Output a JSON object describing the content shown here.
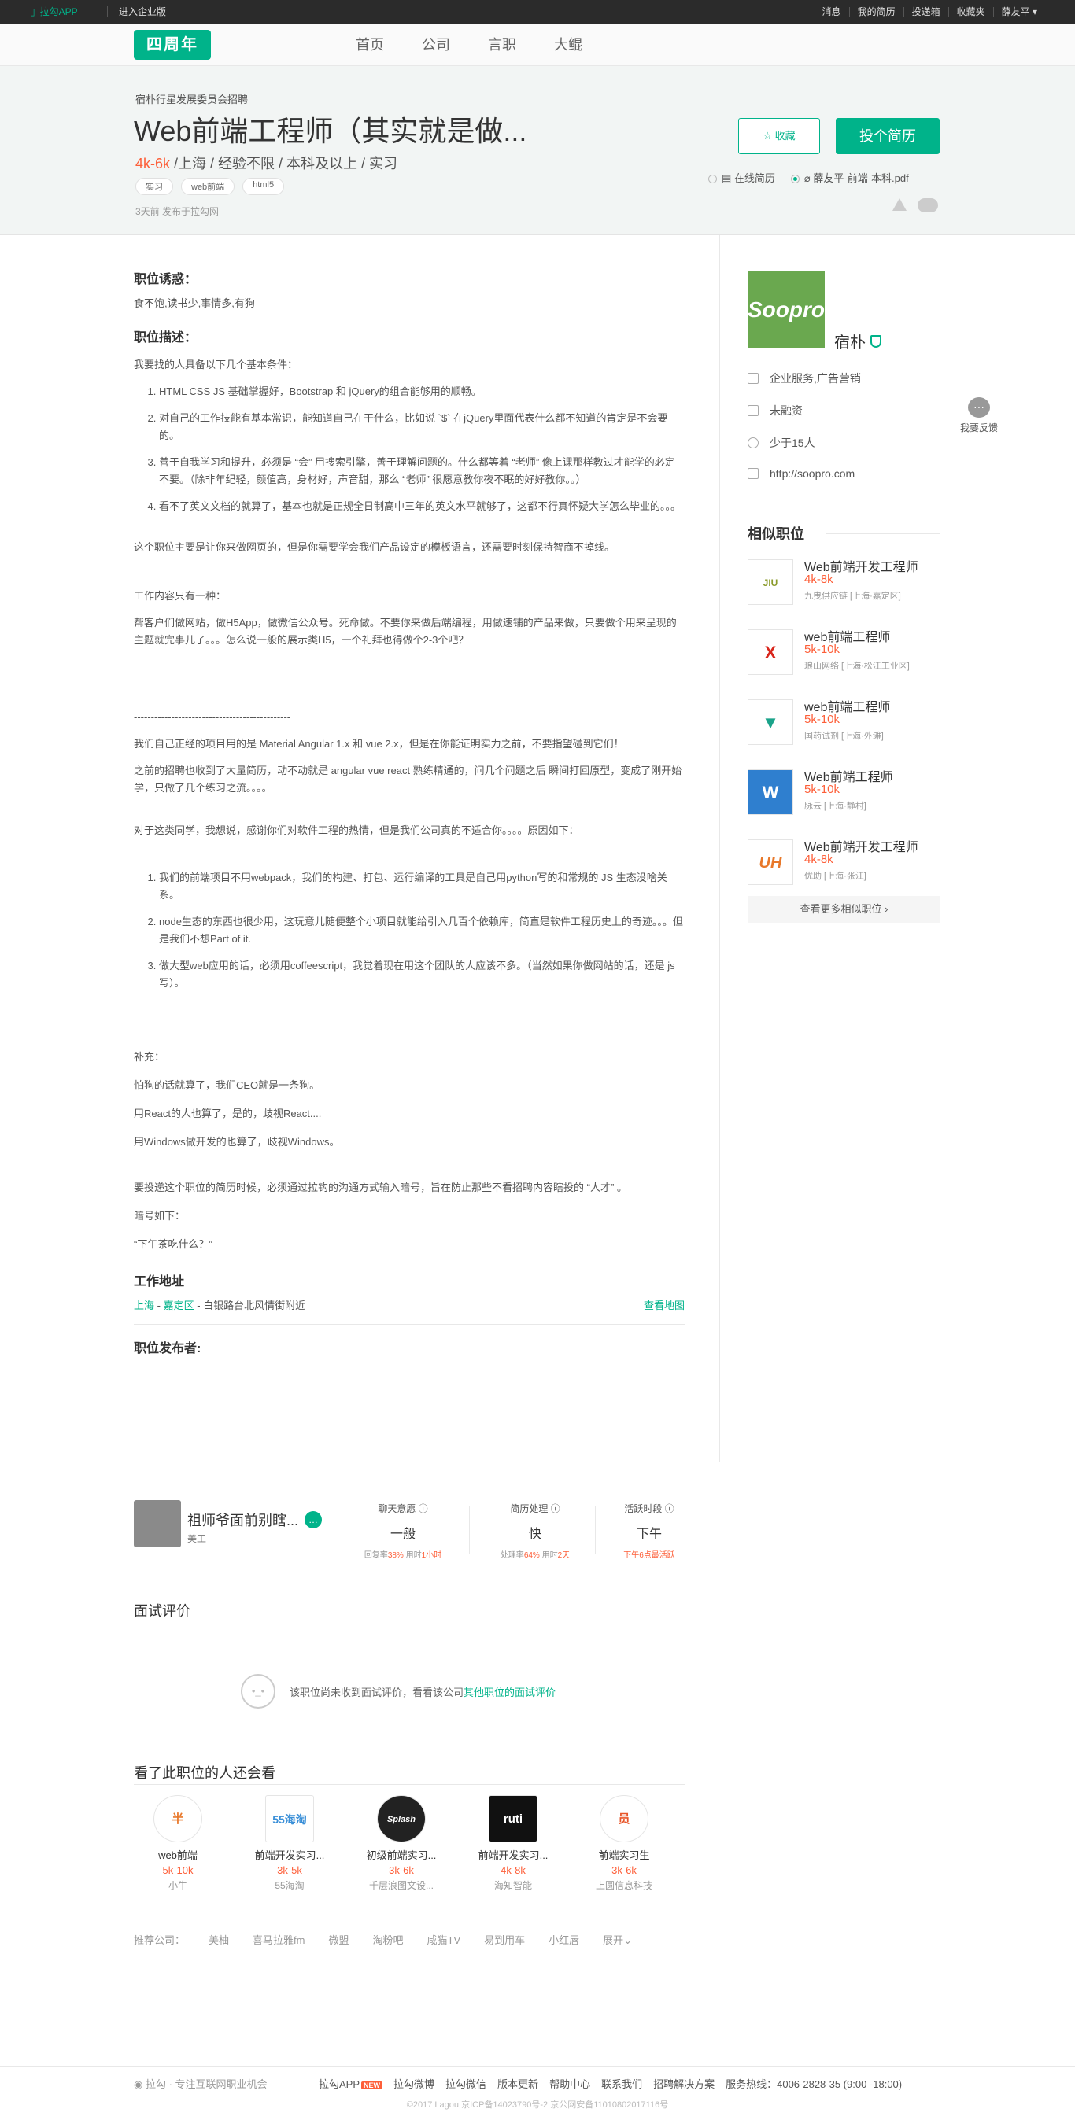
{
  "topbar": {
    "app": "拉勾APP",
    "enterprise": "进入企业版",
    "links": [
      "消息",
      "我的简历",
      "投递箱",
      "收藏夹",
      "薛友平"
    ]
  },
  "nav": {
    "logo": "四周年",
    "links": [
      "首页",
      "公司",
      "言职",
      "大鲲"
    ]
  },
  "job": {
    "company_sub": "宿朴行星发展委员会招聘",
    "title": "Web前端工程师（其实就是做...",
    "salary": "4k-6k",
    "requirements": " /上海 / 经验不限 / 本科及以上 / 实习",
    "tags": [
      "实习",
      "web前端",
      "html5"
    ],
    "published": "3天前  发布于拉勾网",
    "collect": "收藏",
    "apply": "投个简历",
    "resume_online": "在线简历",
    "resume_file": "薛友平-前端-本科.pdf"
  },
  "content": {
    "temptation_title": "职位诱惑：",
    "temptation": "食不饱,读书少,事情多,有狗",
    "desc_title": "职位描述：",
    "intro": "我要找的人具备以下几个基本条件：",
    "req_list": [
      "HTML CSS JS 基础掌握好，Bootstrap 和 jQuery的组合能够用的顺畅。",
      "对自己的工作技能有基本常识，能知道自己在干什么，比如说 `$` 在jQuery里面代表什么都不知道的肯定是不会要的。",
      "善于自我学习和提升，必须是 “会” 用搜索引擎，善于理解问题的。什么都等着 “老师” 像上课那样教过才能学的必定不要。（除非年纪轻，颜值高，身材好，声音甜，那么 “老师” 很愿意教你夜不眠的好好教你。。）",
      "看不了英文文档的就算了，基本也就是正规全日制高中三年的英文水平就够了，这都不行真怀疑大学怎么毕业的。。。"
    ],
    "p_role": "这个职位主要是让你来做网页的，但是你需要学会我们产品设定的模板语言，还需要时刻保持智商不掉线。",
    "p_work_title": "工作内容只有一种：",
    "p_work": "帮客户们做网站，做H5App，做微信公众号。死命做。不要你来做后端编程，用做速铺的产品来做，只要做个用来呈现的主题就完事儿了。。。怎么说一般的展示类H5，一个礼拜也得做个2-3个吧？",
    "divider": "----------------------------------------------",
    "p_proj": "我们自己正经的项目用的是 Material Angular 1.x 和 vue 2.x，但是在你能证明实力之前，不要指望碰到它们！",
    "p_hist": "之前的招聘也收到了大量简历，动不动就是 angular  vue  react 熟练精通的，问几个问题之后 瞬间打回原型，变成了刚开始学，只做了几个练习之流。。。。",
    "p_thanks": "对于这类同学，我想说，感谢你们对软件工程的热情，但是我们公司真的不适合你。。。。原因如下：",
    "reason_list": [
      "我们的前端项目不用webpack，我们的构建、打包、运行编译的工具是自己用python写的和常规的 JS 生态没啥关系。",
      "node生态的东西也很少用，这玩意儿随便整个小项目就能给引入几百个依赖库，简直是软件工程历史上的奇迹。。。但是我们不想Part of it.",
      "做大型web应用的话，必须用coffeescript，我觉着现在用这个团队的人应该不多。（当然如果你做网站的话，还是 js 写）。"
    ],
    "p_supp": "补充：",
    "p_dog": "怕狗的话就算了，我们CEO就是一条狗。",
    "p_react": "用React的人也算了，是的，歧视React....",
    "p_win": "用Windows做开发的也算了，歧视Windows。",
    "p_code": "要投递这个职位的简历时候，必须通过拉钩的沟通方式输入暗号，旨在防止那些不看招聘内容瞎投的 “人才” 。",
    "p_code2": "暗号如下：",
    "p_code3": "“下午茶吃什么？”",
    "addr_title": "工作地址",
    "addr_city": "上海",
    "addr_sep1": " - ",
    "addr_district": "嘉定区",
    "addr_street": " - 白银路台北风情街附近",
    "view_map": "查看地图"
  },
  "publisher": {
    "title": "职位发布者:",
    "name": "祖师爷面前别瞎...",
    "role": "美工",
    "stats": [
      {
        "h": "聊天意愿",
        "v": "一般",
        "n1": "回复率",
        "b1": "38%",
        "n2": "  用时",
        "b2": "1小时"
      },
      {
        "h": "简历处理",
        "v": "快",
        "n1": "处理率",
        "b1": "64%",
        "n2": "  用时",
        "b2": "2天"
      },
      {
        "h": "活跃时段",
        "v": "下午",
        "n1": "下午6点最活跃",
        "b1": "",
        "n2": "",
        "b2": ""
      }
    ]
  },
  "interview": {
    "title": "面试评价",
    "empty": "该职位尚未收到面试评价，看看该公司",
    "link": "其他职位的面试评价"
  },
  "related": {
    "title": "看了此职位的人还会看",
    "items": [
      {
        "logo": "半",
        "t": "web前端",
        "s": "5k-10k",
        "c": "小牛"
      },
      {
        "logo": "55海淘",
        "t": "前端开发实习...",
        "s": "3k-5k",
        "c": "55海淘"
      },
      {
        "logo": "Splash",
        "t": "初级前端实习...",
        "s": "3k-6k",
        "c": "千层浪图文设..."
      },
      {
        "logo": "ruti",
        "t": "前端开发实习...",
        "s": "4k-8k",
        "c": "海知智能"
      },
      {
        "logo": "员",
        "t": "前端实习生",
        "s": "3k-6k",
        "c": "上圆信息科技"
      }
    ]
  },
  "recommend": {
    "label": "推荐公司：",
    "items": [
      "美柚",
      "喜马拉雅fm",
      "微盟",
      "淘粉吧",
      "咸猫TV",
      "易到用车",
      "小红唇"
    ],
    "more": "展开"
  },
  "sidebar": {
    "company_logo": "Soopro",
    "company": "宿朴",
    "info": [
      "企业服务,广告营销",
      "未融资",
      "少于15人",
      "http://soopro.com"
    ],
    "similar_title": "相似职位",
    "similar": [
      {
        "logo": "JIU",
        "t": "Web前端开发工程师",
        "s": "4k-8k",
        "c": "九曳供应链 [上海·嘉定区]",
        "color": "#8a9a2a"
      },
      {
        "logo": "X",
        "t": "web前端工程师",
        "s": "5k-10k",
        "c": "琅山网络 [上海·松江工业区]",
        "color": "#d9261c"
      },
      {
        "logo": "▼",
        "t": "web前端工程师",
        "s": "5k-10k",
        "c": "国药试剂 [上海·外滩]",
        "color": "#1aa38a"
      },
      {
        "logo": "W",
        "t": "Web前端工程师",
        "s": "5k-10k",
        "c": "脉云 [上海·静村]",
        "color": "#2f7fcf"
      },
      {
        "logo": "UH",
        "t": "Web前端开发工程师",
        "s": "4k-8k",
        "c": "优助 [上海·张江]",
        "color": "#e8782a"
      }
    ],
    "more": "查看更多相似职位"
  },
  "feedback": "我要反馈",
  "footer": {
    "brand": "拉勾 · 专注互联网职业机会",
    "links": [
      "拉勾APP",
      "拉勾微博",
      "拉勾微信",
      "版本更新",
      "帮助中心",
      "联系我们",
      "招聘解决方案",
      "服务热线：4006-2828-35 (9:00 -18:00)"
    ],
    "new": "NEW",
    "copyright": "©2017 Lagou 京ICP备14023790号-2 京公网安备11010802017116号"
  }
}
